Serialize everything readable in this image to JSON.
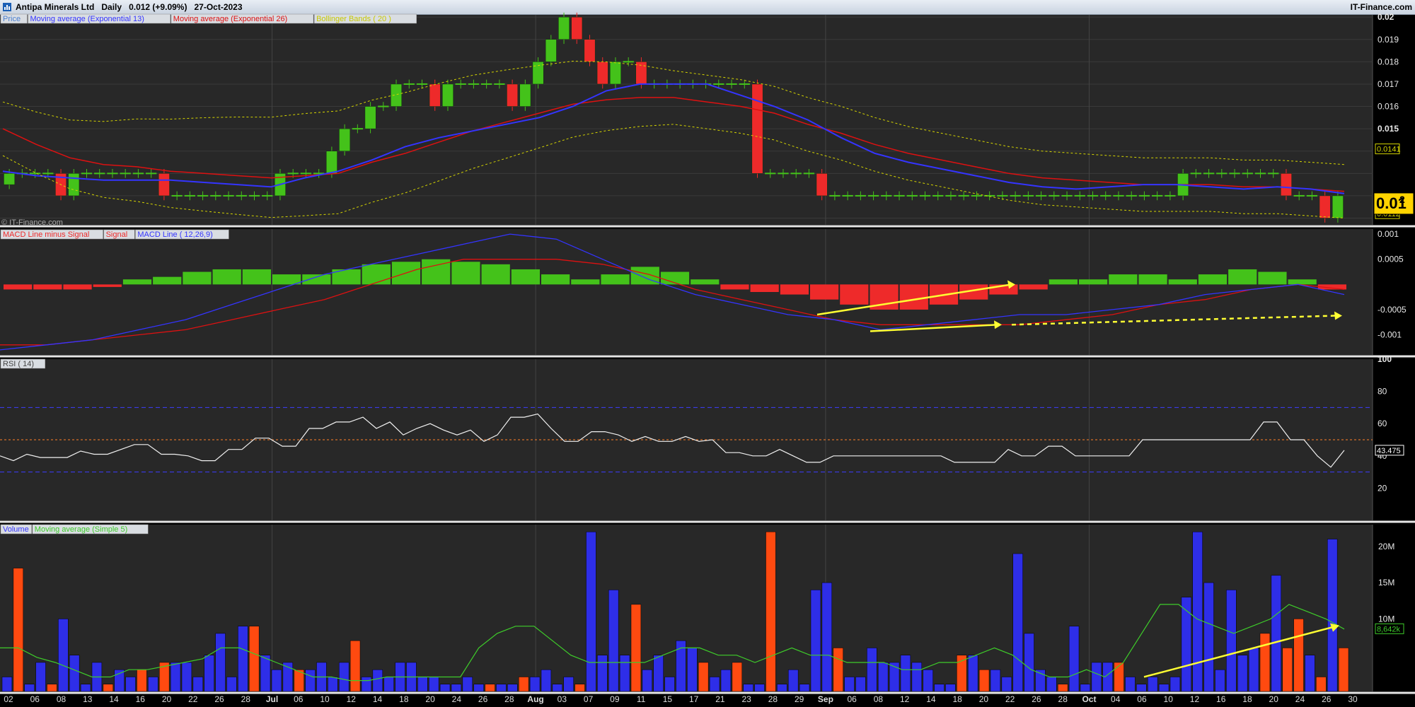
{
  "header": {
    "security": "Antipa Minerals Ltd",
    "period": "Daily",
    "price_change": "0.012 (+9.09%)",
    "date": "27-Oct-2023",
    "brand": "IT-Finance.com"
  },
  "panels": {
    "price": {
      "legend": [
        "Price",
        "Moving average (Exponential 13)",
        "Moving average (Exponential 26)",
        "Bollinger Bands ( 20 )"
      ],
      "watermark": "© IT-Finance.com",
      "y_ticks": [
        "0.02",
        "0.019",
        "0.018",
        "0.017",
        "0.016",
        "0.015",
        "0.0141",
        "0.012",
        "0.0112"
      ],
      "last_price_main": "0.01",
      "last_price_sup": "2"
    },
    "macd": {
      "legend": [
        "MACD Line minus Signal",
        "Signal",
        "MACD Line ( 12,26,9)"
      ],
      "y_ticks": [
        "0.001",
        "0.0005",
        "-0.0005",
        "-0.001"
      ]
    },
    "rsi": {
      "legend": [
        "RSI ( 14)"
      ],
      "y_ticks": [
        "100",
        "80",
        "60",
        "40",
        "20"
      ],
      "current": "43.475"
    },
    "volume": {
      "legend": [
        "Volume",
        "Moving average (Simple 5)"
      ],
      "y_ticks": [
        "20M",
        "15M",
        "10M"
      ],
      "ma_value": "8,642k"
    }
  },
  "x_axis": {
    "labels": [
      "02",
      "06",
      "08",
      "13",
      "14",
      "16",
      "20",
      "22",
      "26",
      "28",
      "Jul",
      "06",
      "10",
      "12",
      "14",
      "18",
      "20",
      "24",
      "26",
      "28",
      "Aug",
      "03",
      "07",
      "09",
      "11",
      "15",
      "17",
      "21",
      "23",
      "28",
      "29",
      "Sep",
      "06",
      "08",
      "12",
      "14",
      "18",
      "20",
      "22",
      "26",
      "28",
      "Oct",
      "04",
      "06",
      "10",
      "12",
      "16",
      "18",
      "20",
      "24",
      "26",
      "30"
    ],
    "bold": [
      "Jul",
      "Aug",
      "Sep",
      "Oct"
    ]
  },
  "colors": {
    "up": "#44c21a",
    "down": "#ee2a2a",
    "ema13": "#3434ff",
    "ema26": "#dd1111",
    "bollinger": "#d4d400",
    "volume_up": "#2e2ee8",
    "volume_down": "#ff4a10",
    "trendline": "#ffff33"
  },
  "chart_data": [
    {
      "type": "candlestick",
      "title": "Antipa Minerals Ltd Daily",
      "ylim": [
        0.0107,
        0.0201
      ],
      "series": [
        {
          "name": "Price (closes, approx.)",
          "values": [
            0.013,
            0.013,
            0.013,
            0.013,
            0.012,
            0.013,
            0.013,
            0.013,
            0.013,
            0.013,
            0.013,
            0.013,
            0.012,
            0.012,
            0.012,
            0.012,
            0.012,
            0.012,
            0.012,
            0.012,
            0.012,
            0.013,
            0.013,
            0.013,
            0.013,
            0.014,
            0.015,
            0.015,
            0.016,
            0.016,
            0.017,
            0.017,
            0.017,
            0.016,
            0.017,
            0.017,
            0.017,
            0.017,
            0.017,
            0.016,
            0.017,
            0.018,
            0.019,
            0.02,
            0.019,
            0.018,
            0.017,
            0.018,
            0.018,
            0.017,
            0.017,
            0.017,
            0.017,
            0.017,
            0.017,
            0.017,
            0.017,
            0.017,
            0.013,
            0.013,
            0.013,
            0.013,
            0.013,
            0.012,
            0.012,
            0.012,
            0.012,
            0.012,
            0.012,
            0.012,
            0.012,
            0.012,
            0.012,
            0.012,
            0.012,
            0.012,
            0.012,
            0.012,
            0.012,
            0.012,
            0.012,
            0.012,
            0.012,
            0.012,
            0.012,
            0.012,
            0.012,
            0.012,
            0.012,
            0.012,
            0.012,
            0.013,
            0.013,
            0.013,
            0.013,
            0.013,
            0.013,
            0.013,
            0.013,
            0.012,
            0.012,
            0.012,
            0.011,
            0.012
          ]
        },
        {
          "name": "Moving average (Exponential 13)",
          "values": [
            0.0131,
            0.0129,
            0.0128,
            0.0127,
            0.0127,
            0.0127,
            0.0126,
            0.0125,
            0.0124,
            0.0128,
            0.0131,
            0.0136,
            0.0142,
            0.0146,
            0.0149,
            0.0152,
            0.0155,
            0.016,
            0.0167,
            0.017,
            0.017,
            0.017,
            0.0165,
            0.016,
            0.0154,
            0.0146,
            0.0139,
            0.0135,
            0.0132,
            0.0129,
            0.0126,
            0.0124,
            0.0123,
            0.0124,
            0.0125,
            0.0125,
            0.0124,
            0.0123,
            0.0124,
            0.0123,
            0.0121
          ]
        },
        {
          "name": "Moving average (Exponential 26)",
          "values": [
            0.015,
            0.0143,
            0.0137,
            0.0134,
            0.0133,
            0.0131,
            0.013,
            0.0129,
            0.0128,
            0.0129,
            0.013,
            0.0135,
            0.0139,
            0.0144,
            0.0149,
            0.0153,
            0.0157,
            0.0161,
            0.0163,
            0.0164,
            0.0164,
            0.0162,
            0.016,
            0.0157,
            0.0152,
            0.0148,
            0.0143,
            0.0139,
            0.0136,
            0.0133,
            0.013,
            0.0128,
            0.0127,
            0.0126,
            0.0125,
            0.0125,
            0.0125,
            0.0124,
            0.0124,
            0.0123,
            0.0122
          ]
        }
      ]
    },
    {
      "type": "bar",
      "title": "MACD ( 12,26,9)",
      "ylim": [
        -0.0014,
        0.0011
      ],
      "series": [
        {
          "name": "MACD Line minus Signal",
          "values": [
            -0.0001,
            -0.0001,
            -0.0001,
            -5e-05,
            0.0001,
            0.00015,
            0.00025,
            0.0003,
            0.0003,
            0.0002,
            0.0002,
            0.0003,
            0.0004,
            0.00045,
            0.0005,
            0.00045,
            0.0004,
            0.0003,
            0.0002,
            0.0001,
            0.0002,
            0.00035,
            0.00025,
            0.0001,
            -0.0001,
            -0.00015,
            -0.0002,
            -0.0003,
            -0.0004,
            -0.0005,
            -0.0005,
            -0.0004,
            -0.0003,
            -0.0002,
            -0.0001,
            0.0001,
            0.0001,
            0.0002,
            0.0002,
            0.0001,
            0.0002,
            0.0003,
            0.00025,
            0.0001,
            -0.0001
          ]
        },
        {
          "name": "MACD Line",
          "values": [
            -0.0013,
            -0.0012,
            -0.0011,
            -0.0009,
            -0.0007,
            -0.0004,
            -0.0001,
            0.0002,
            0.0004,
            0.0006,
            0.0008,
            0.001,
            0.0009,
            0.0005,
            0.0001,
            -0.0002,
            -0.0004,
            -0.0006,
            -0.0007,
            -0.0009,
            -0.0008,
            -0.0007,
            -0.0006,
            -0.0006,
            -0.0005,
            -0.0004,
            -0.0002,
            -0.0001,
            0.0,
            -0.0002
          ]
        },
        {
          "name": "Signal",
          "values": [
            -0.0012,
            -0.0012,
            -0.0011,
            -0.001,
            -0.0009,
            -0.0007,
            -0.0005,
            -0.0003,
            0.0,
            0.0003,
            0.0005,
            0.0005,
            0.0005,
            0.0004,
            0.0002,
            -0.0001,
            -0.0003,
            -0.0005,
            -0.0007,
            -0.0008,
            -0.0008,
            -0.0008,
            -0.0008,
            -0.0007,
            -0.0006,
            -0.0004,
            -0.0003,
            -0.0001,
            0.0,
            -0.0001
          ]
        }
      ]
    },
    {
      "type": "line",
      "title": "RSI ( 14)",
      "ylim": [
        0,
        100
      ],
      "series": [
        {
          "name": "RSI ( 14)",
          "values": [
            40,
            37,
            41,
            39,
            39,
            39,
            43,
            41,
            41,
            44,
            47,
            47,
            41,
            41,
            40,
            37,
            37,
            44,
            44,
            51,
            51,
            46,
            46,
            57,
            57,
            61,
            61,
            64,
            57,
            61,
            53,
            57,
            60,
            56,
            53,
            56,
            49,
            53,
            64,
            64,
            66,
            57,
            49,
            49,
            55,
            55,
            53,
            49,
            52,
            49,
            49,
            52,
            49,
            50,
            42,
            42,
            40,
            40,
            44,
            40,
            36,
            36,
            40,
            40,
            40,
            40,
            40,
            40,
            40,
            40,
            40,
            36,
            36,
            36,
            36,
            44,
            40,
            40,
            46,
            46,
            40,
            40,
            40,
            40,
            40,
            50,
            50,
            50,
            50,
            50,
            50,
            50,
            50,
            50,
            61,
            61,
            50,
            50,
            40,
            33,
            43.475
          ]
        }
      ]
    },
    {
      "type": "bar",
      "title": "Volume",
      "ylim": [
        0,
        23000000
      ],
      "series": [
        {
          "name": "Volume (M)",
          "values": [
            2,
            17,
            1,
            4,
            1,
            10,
            5,
            1,
            4,
            1,
            3,
            2,
            3,
            2,
            4,
            4,
            4,
            2,
            5,
            8,
            2,
            9,
            9,
            5,
            3,
            4,
            3,
            3,
            4,
            2,
            4,
            7,
            2,
            3,
            2,
            4,
            4,
            2,
            2,
            1,
            1,
            2,
            1,
            1,
            1,
            1,
            2,
            2,
            3,
            1,
            2,
            1,
            22,
            5,
            14,
            5,
            12,
            3,
            5,
            2,
            7,
            6,
            4,
            2,
            3,
            4,
            1,
            1,
            22,
            1,
            3,
            1,
            14,
            15,
            6,
            2,
            2,
            6,
            4,
            4,
            5,
            4,
            3,
            1,
            1,
            5,
            5,
            3,
            3,
            2,
            19,
            8,
            3,
            2,
            1,
            9,
            1,
            4,
            4,
            4,
            2,
            1,
            2,
            1,
            2,
            13,
            22,
            15,
            3,
            14,
            5,
            6,
            8,
            16,
            6,
            10,
            5,
            2,
            21,
            6
          ]
        },
        {
          "name": "Moving average (Simple 5)",
          "values": [
            6,
            6,
            4.7,
            4,
            3,
            2,
            2,
            3,
            3,
            3.5,
            4,
            4.5,
            6,
            6,
            5,
            4,
            3,
            2,
            2,
            1.5,
            1.5,
            2,
            2,
            2,
            2,
            2,
            6,
            8,
            9,
            9,
            7,
            5,
            4,
            4,
            4,
            4,
            5,
            6,
            6,
            5,
            5,
            4,
            5,
            6,
            5,
            5,
            4,
            4,
            4,
            3,
            3,
            4,
            4,
            5,
            6,
            5,
            3,
            2,
            2,
            3,
            2,
            4,
            8,
            12,
            12,
            10,
            9,
            8,
            9,
            10,
            12,
            11,
            10,
            8.6
          ]
        }
      ]
    }
  ]
}
